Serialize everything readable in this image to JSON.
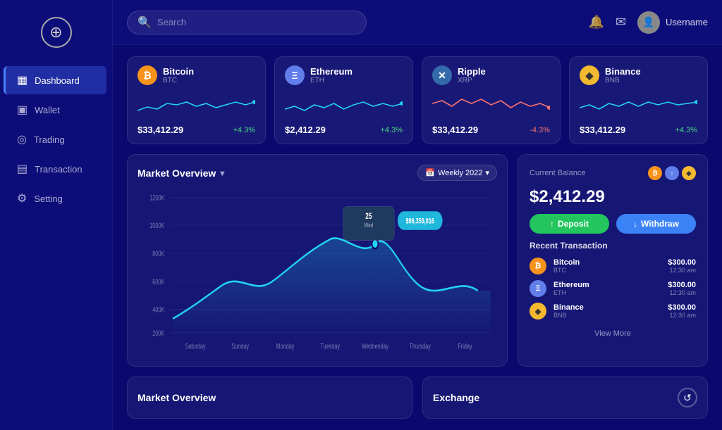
{
  "app": {
    "logo_icon": "⊕",
    "search_placeholder": "Search"
  },
  "sidebar": {
    "items": [
      {
        "id": "dashboard",
        "label": "Dashboard",
        "icon": "▦",
        "active": true
      },
      {
        "id": "wallet",
        "label": "Wallet",
        "icon": "▣",
        "active": false
      },
      {
        "id": "trading",
        "label": "Trading",
        "icon": "◎",
        "active": false
      },
      {
        "id": "transaction",
        "label": "Transaction",
        "icon": "▤",
        "active": false
      },
      {
        "id": "setting",
        "label": "Setting",
        "icon": "⚙",
        "active": false
      }
    ]
  },
  "topbar": {
    "username": "Username"
  },
  "coins": [
    {
      "id": "btc",
      "name": "Bitcoin",
      "symbol": "BTC",
      "price": "$33,412.29",
      "change": "+4.3%",
      "positive": true
    },
    {
      "id": "eth",
      "name": "Ethereum",
      "symbol": "ETH",
      "price": "$2,412.29",
      "change": "+4.3%",
      "positive": true
    },
    {
      "id": "xrp",
      "name": "Ripple",
      "symbol": "XRP",
      "price": "$33,412.29",
      "change": "-4.3%",
      "positive": false
    },
    {
      "id": "bnb",
      "name": "Binance",
      "symbol": "BNB",
      "price": "$33,412.29",
      "change": "+4.3%",
      "positive": true
    }
  ],
  "market_chart": {
    "title": "Market Overview",
    "period": "Weekly 2022",
    "tooltip_day": "25",
    "tooltip_label": "Wed",
    "tooltip_value": "$96,359,016",
    "y_labels": [
      "1200K",
      "1000K",
      "800K",
      "600K",
      "400K",
      "200K"
    ],
    "x_labels": [
      "Saturday",
      "Sunday",
      "Monday",
      "Tuesday",
      "Wednesday",
      "Thursday",
      "Friday"
    ]
  },
  "balance": {
    "label": "Current Balance",
    "amount": "$2,412.29",
    "deposit_label": "Deposit",
    "withdraw_label": "Withdraw",
    "recent_tx_label": "Recent Transaction",
    "transactions": [
      {
        "name": "Bitcoin",
        "symbol": "BTC",
        "amount": "$300.00",
        "time": "12:30 am",
        "icon_class": "btc"
      },
      {
        "name": "Ethereum",
        "symbol": "ETH",
        "amount": "$300.00",
        "time": "12:30 am",
        "icon_class": "eth"
      },
      {
        "name": "Binance",
        "symbol": "BNB",
        "amount": "$300.00",
        "time": "12:30 am",
        "icon_class": "bnb"
      }
    ],
    "view_more": "View More"
  },
  "bottom_cards": [
    {
      "id": "market_overview",
      "title": "Market Overview"
    },
    {
      "id": "exchange",
      "title": "Exchange",
      "icon": "↺"
    }
  ]
}
